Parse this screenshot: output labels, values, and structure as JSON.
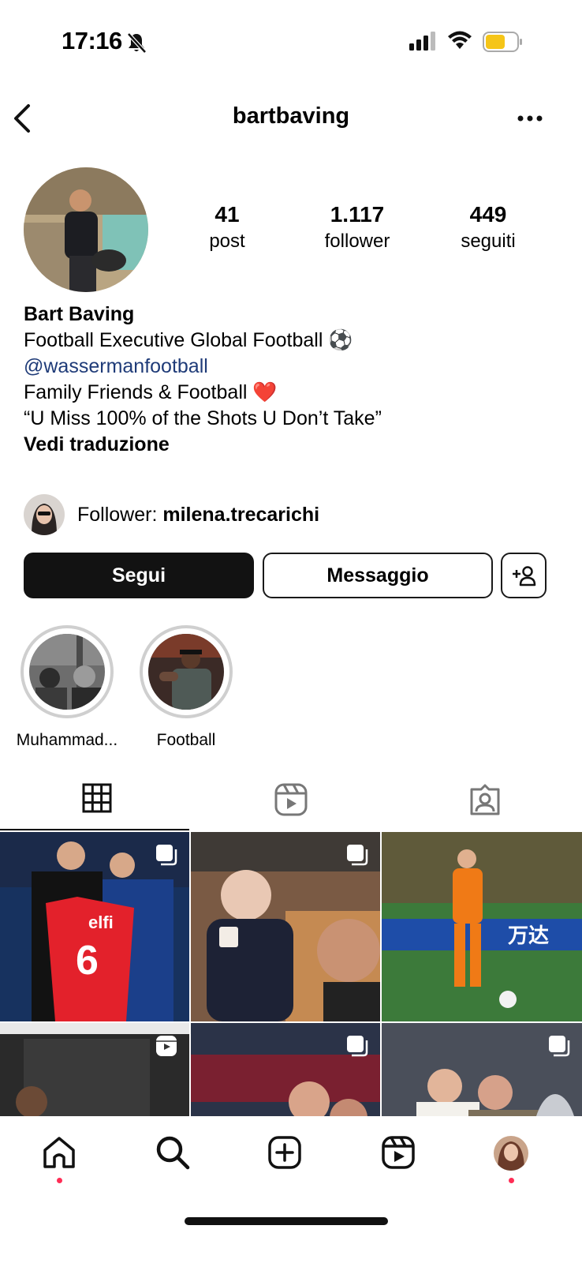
{
  "status_bar": {
    "time": "17:16"
  },
  "header": {
    "username": "bartbaving"
  },
  "profile": {
    "stats": [
      {
        "value": "41",
        "label": "post"
      },
      {
        "value": "1.117",
        "label": "follower"
      },
      {
        "value": "449",
        "label": "seguiti"
      }
    ],
    "name": "Bart Baving",
    "bio_line1": "Football Executive Global Football ⚽",
    "mention": "@wassermanfootball",
    "bio_line2": "Family Friends & Football ❤️",
    "bio_line3": "“U Miss 100% of the Shots U Don’t Take”",
    "translate_label": "Vedi traduzione"
  },
  "followed_by": {
    "prefix": "Follower: ",
    "user": "milena.trecarichi"
  },
  "buttons": {
    "follow": "Segui",
    "message": "Messaggio"
  },
  "highlights": [
    {
      "label": "Muhammad..."
    },
    {
      "label": "Football"
    }
  ],
  "bottom_nav": [
    "home-icon",
    "search-icon",
    "new-post-icon",
    "reels-icon",
    "profile-avatar"
  ],
  "colors": {
    "mention": "#1f3b78",
    "notification_dot": "#ff2d55",
    "battery": "#f5c518"
  }
}
